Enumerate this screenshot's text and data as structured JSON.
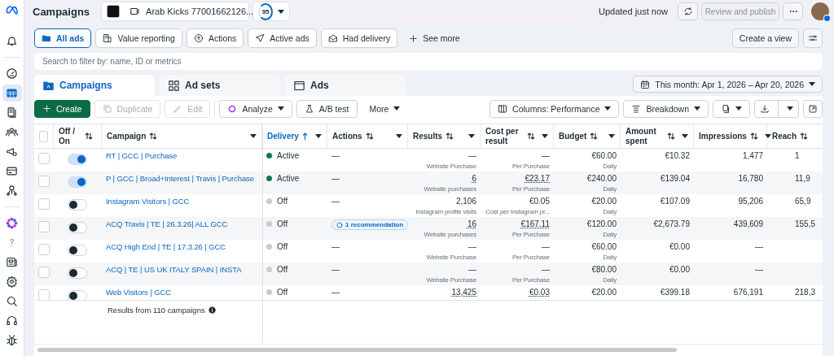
{
  "header": {
    "title": "Campaigns",
    "account": "Arab Kicks 77001662126...",
    "score": "95",
    "updated": "Updated just now",
    "publish": {
      "label": "Review and publish",
      "disabled": true
    }
  },
  "sidebar": {
    "items": [
      {
        "selected": false
      },
      {
        "selected": false
      },
      {
        "selected": true
      },
      {
        "selected": false
      },
      {
        "selected": false
      },
      {
        "selected": false
      },
      {
        "selected": false
      },
      {
        "selected": false
      },
      {
        "selected": false
      },
      {
        "selected": false
      },
      {
        "selected": false
      },
      {
        "selected": false
      },
      {
        "selected": false
      },
      {
        "selected": false
      },
      {
        "selected": false
      }
    ]
  },
  "filters": {
    "chips": [
      {
        "label": "All ads",
        "selected": true
      },
      {
        "label": "Value reporting",
        "selected": false
      },
      {
        "label": "Actions",
        "selected": false
      },
      {
        "label": "Active ads",
        "selected": false
      },
      {
        "label": "Had delivery",
        "selected": false
      }
    ],
    "see_more": "See more",
    "create_view": "Create a view"
  },
  "search": {
    "placeholder": "Search to filter by: name, ID or metrics"
  },
  "tabs": [
    {
      "label": "Campaigns",
      "selected": true
    },
    {
      "label": "Ad sets",
      "selected": false
    },
    {
      "label": "Ads",
      "selected": false
    }
  ],
  "date_range": "This month: Apr 1, 2026 – Apr 20, 2026",
  "toolbar": {
    "buttons": [
      {
        "label": "Create",
        "kind": "primary",
        "disabled": false
      },
      {
        "label": "Duplicate",
        "kind": "plain",
        "disabled": true
      },
      {
        "label": "Edit",
        "kind": "plain",
        "disabled": true
      },
      {
        "label": "Analyze",
        "kind": "menu",
        "disabled": false
      },
      {
        "label": "A/B test",
        "kind": "plain",
        "disabled": false
      },
      {
        "label": "More",
        "kind": "menu",
        "disabled": false
      }
    ],
    "columns": "Columns: Performance",
    "breakdown": "Breakdown"
  },
  "table": {
    "columns": [
      {
        "label": "Off / On",
        "sorted": false,
        "menu": false
      },
      {
        "label": "Campaign",
        "sorted": false,
        "menu": true
      },
      {
        "label": "Delivery",
        "sorted": true,
        "menu": true
      },
      {
        "label": "Actions",
        "sorted": false,
        "menu": true
      },
      {
        "label": "Results",
        "sorted": false,
        "menu": true
      },
      {
        "label": "Cost per result",
        "sorted": false,
        "menu": true
      },
      {
        "label": "Budget",
        "sorted": false,
        "menu": true
      },
      {
        "label": "Amount spent",
        "sorted": false,
        "menu": true
      },
      {
        "label": "Impressions",
        "sorted": false,
        "menu": true
      },
      {
        "label": "Reach",
        "sorted": false
      }
    ],
    "select_all_checked": false,
    "rows": [
      {
        "checked": false,
        "on": true,
        "name": "RT | GCC | Purchase",
        "delivery": {
          "label": "Active",
          "color": "#0a7c4a"
        },
        "action": {
          "kind": "none",
          "label": "—"
        },
        "results": {
          "value": "—",
          "note": "Website Purchase",
          "dotted": false
        },
        "cost": {
          "value": "—",
          "note": "Per Purchase",
          "dotted": false
        },
        "budget": {
          "value": "€60.00",
          "note": "Daily"
        },
        "spent": "€10.32",
        "impressions": "1,477",
        "reach": "1"
      },
      {
        "checked": false,
        "on": true,
        "name": "P | GCC | Broad+Interest | Travis | Purchase",
        "delivery": {
          "label": "Active",
          "color": "#0a7c4a"
        },
        "action": {
          "kind": "none",
          "label": "—"
        },
        "results": {
          "value": "6",
          "note": "Website purchases",
          "dotted": true
        },
        "cost": {
          "value": "€23.17",
          "note": "Per Purchase",
          "dotted": true
        },
        "budget": {
          "value": "€240.00",
          "note": "Daily"
        },
        "spent": "€139.04",
        "impressions": "16,780",
        "reach": "11,9"
      },
      {
        "checked": false,
        "on": false,
        "name": "Instagram Visitors | GCC",
        "delivery": {
          "label": "Off",
          "color": "#c9ccd1"
        },
        "action": {
          "kind": "none",
          "label": "—"
        },
        "results": {
          "value": "2,106",
          "note": "Instagram profile visits",
          "dotted": false
        },
        "cost": {
          "value": "€0.05",
          "note": "Cost per Instagram pr...",
          "dotted": false
        },
        "budget": {
          "value": "€20.00",
          "note": "Daily"
        },
        "spent": "€107.09",
        "impressions": "95,206",
        "reach": "65,9"
      },
      {
        "checked": false,
        "on": false,
        "name": "ACQ Travis | TE | 26.3.26| ALL GCC",
        "delivery": {
          "label": "Off",
          "color": "#c9ccd1"
        },
        "action": {
          "kind": "badge",
          "label": "1 recommendation"
        },
        "results": {
          "value": "16",
          "note": "Website purchases",
          "dotted": true
        },
        "cost": {
          "value": "€167.11",
          "note": "Per Purchase",
          "dotted": true
        },
        "budget": {
          "value": "€120.00",
          "note": "Daily"
        },
        "spent": "€2,673.79",
        "impressions": "439,609",
        "reach": "155,5"
      },
      {
        "checked": false,
        "on": false,
        "name": "ACQ High End | TE | 17.3.26 | GCC",
        "delivery": {
          "label": "Off",
          "color": "#c9ccd1"
        },
        "action": {
          "kind": "none",
          "label": "—"
        },
        "results": {
          "value": "—",
          "note": "Website Purchase",
          "dotted": false
        },
        "cost": {
          "value": "—",
          "note": "Per Purchase",
          "dotted": false
        },
        "budget": {
          "value": "€60.00",
          "note": "Daily"
        },
        "spent": "€0.00",
        "impressions": "—"
      },
      {
        "checked": false,
        "on": false,
        "name": "ACQ | TE | US UK ITALY SPAIN | INSTA",
        "delivery": {
          "label": "Off",
          "color": "#c9ccd1"
        },
        "action": {
          "kind": "none",
          "label": "—"
        },
        "results": {
          "value": "—",
          "note": "Website Purchase",
          "dotted": false
        },
        "cost": {
          "value": "—",
          "note": "Per Purchase",
          "dotted": false
        },
        "budget": {
          "value": "€80.00",
          "note": "Daily"
        },
        "spent": "€0.00",
        "impressions": "—"
      },
      {
        "checked": false,
        "on": false,
        "name": "Web Visitors | GCC",
        "delivery": {
          "label": "Off",
          "color": "#c9ccd1"
        },
        "action": {
          "kind": "none",
          "label": "—"
        },
        "results": {
          "value": "13,425",
          "dotted": true
        },
        "cost": {
          "value": "€0.03",
          "dotted": true
        },
        "budget": {
          "value": "€20.00"
        },
        "spent": "€399.18",
        "impressions": "676,191",
        "reach": "218,3"
      }
    ],
    "footer": "Results from 110 campaigns"
  }
}
